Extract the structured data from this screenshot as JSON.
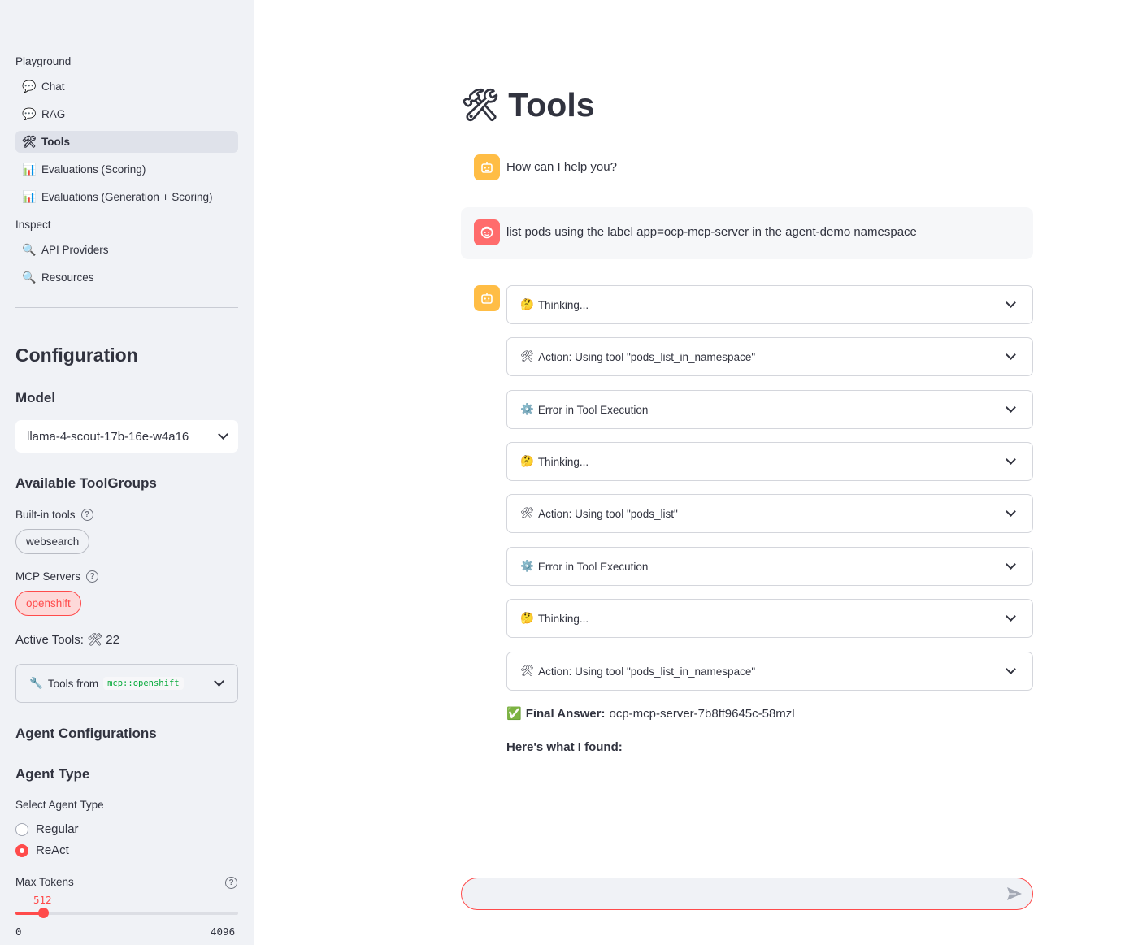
{
  "sidebar": {
    "sections": {
      "playground": "Playground",
      "inspect": "Inspect"
    },
    "nav": [
      {
        "icon": "💬",
        "icon_name": "speech-bubble-icon",
        "label": "Chat"
      },
      {
        "icon": "💬",
        "icon_name": "speech-bubble-icon",
        "label": "RAG"
      },
      {
        "icon": "🛠",
        "icon_name": "hammer-wrench-icon",
        "label": "Tools",
        "active": true
      },
      {
        "icon": "📊",
        "icon_name": "bar-chart-icon",
        "label": "Evaluations (Scoring)"
      },
      {
        "icon": "📊",
        "icon_name": "bar-chart-icon",
        "label": "Evaluations (Generation + Scoring)"
      },
      {
        "icon": "🔍",
        "icon_name": "magnifier-icon",
        "label": "API Providers"
      },
      {
        "icon": "🔍",
        "icon_name": "magnifier-icon",
        "label": "Resources"
      }
    ],
    "config": {
      "heading": "Configuration",
      "model_heading": "Model",
      "model_value": "llama-4-scout-17b-16e-w4a16",
      "toolgroups_heading": "Available ToolGroups",
      "builtin_label": "Built-in tools",
      "builtin_pill": "websearch",
      "mcp_label": "MCP Servers",
      "mcp_pill": "openshift",
      "active_tools": "Active Tools: 🛠 22",
      "tools_from_icon": "🔧",
      "tools_from_label": "Tools from",
      "tools_from_code": "mcp::openshift",
      "agent_config_heading": "Agent Configurations",
      "agent_type_heading": "Agent Type",
      "select_agent_label": "Select Agent Type",
      "agent_options": [
        "Regular",
        "ReAct"
      ],
      "agent_selected": "ReAct",
      "max_tokens_label": "Max Tokens",
      "max_tokens_value": "512",
      "max_tokens_min": "0",
      "max_tokens_max": "4096",
      "max_tokens_fraction": 0.125
    }
  },
  "main": {
    "title_icon": "🛠",
    "title": "Tools",
    "assistant_greeting": "How can I help you?",
    "user_message": "list pods using the label app=ocp-mcp-server in the agent-demo namespace",
    "steps": [
      {
        "icon": "🤔",
        "label": "Thinking..."
      },
      {
        "icon": "🛠",
        "label": "Action: Using tool \"pods_list_in_namespace\""
      },
      {
        "icon": "⚙️",
        "label": "Error in Tool Execution"
      },
      {
        "icon": "🤔",
        "label": "Thinking..."
      },
      {
        "icon": "🛠",
        "label": "Action: Using tool \"pods_list\""
      },
      {
        "icon": "⚙️",
        "label": "Error in Tool Execution"
      },
      {
        "icon": "🤔",
        "label": "Thinking..."
      },
      {
        "icon": "🛠",
        "label": "Action: Using tool \"pods_list_in_namespace\""
      }
    ],
    "final_icon": "✅",
    "final_label": "Final Answer:",
    "final_value": "ocp-mcp-server-7b8ff9645c-58mzl",
    "found_text": "Here's what I found:",
    "chat_input_value": ""
  },
  "colors": {
    "accent": "#ff4b4b",
    "sidebar_bg": "#f0f2f6",
    "bot_avatar": "#ffbd45",
    "user_avatar": "#ff6c6c"
  }
}
